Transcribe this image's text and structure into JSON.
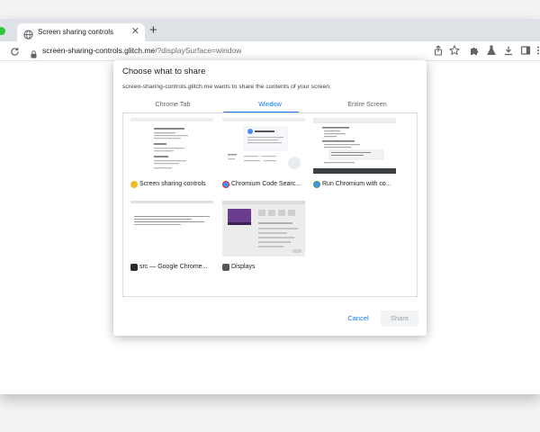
{
  "browser": {
    "tab": {
      "title": "Screen sharing controls",
      "close_glyph": "✕"
    },
    "new_tab_glyph": "+",
    "address": {
      "host": "screen-sharing-controls.glitch.me",
      "path": "/?displaySurface=window"
    },
    "toolbar_icons": [
      "share-icon",
      "star-icon",
      "extensions-icon",
      "flask-icon",
      "download-icon",
      "sidepanel-icon",
      "menu-icon"
    ]
  },
  "dialog": {
    "title": "Choose what to share",
    "description": "screen-sharing-controls.glitch.me wants to share the contents of your screen.",
    "tabs": [
      {
        "label": "Chrome Tab"
      },
      {
        "label": "Window",
        "active": true
      },
      {
        "label": "Entire Screen"
      }
    ],
    "windows": [
      {
        "name": "Screen sharing controls",
        "icon": "glitch-icon",
        "icon_color": "#f2b92c"
      },
      {
        "name": "Chromium Code Searc...",
        "icon": "chromium-icon",
        "icon_color": "#4b8bf4"
      },
      {
        "name": "Run Chromium with co...",
        "icon": "chromium-icon",
        "icon_color": "#4b8bf4"
      },
      {
        "name": "src — Google Chrome...",
        "icon": "terminal-icon",
        "icon_color": "#2b2b2b"
      },
      {
        "name": "Displays",
        "icon": "displays-icon",
        "icon_color": "#555555"
      }
    ],
    "buttons": {
      "cancel": "Cancel",
      "share": "Share"
    }
  },
  "colors": {
    "accent": "#1a73e8",
    "tabstrip": "#dee1e6"
  }
}
